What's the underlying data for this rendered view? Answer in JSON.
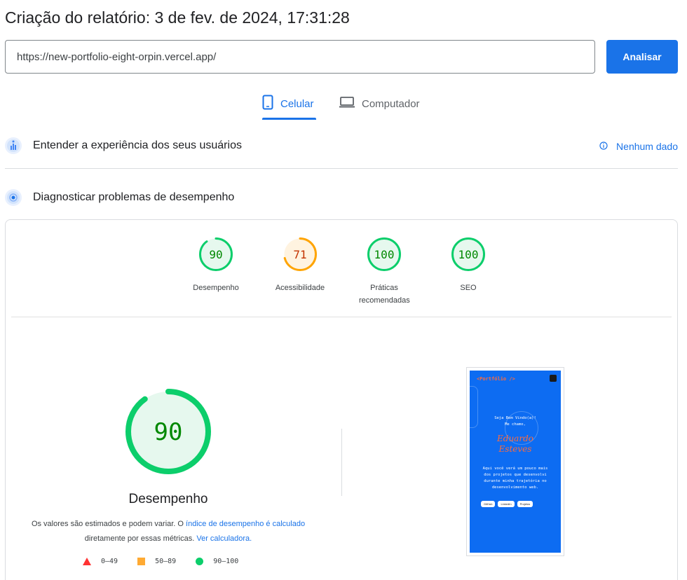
{
  "header": {
    "title": "Criação do relatório: 3 de fev. de 2024, 17:31:28"
  },
  "search": {
    "url": "https://new-portfolio-eight-orpin.vercel.app/",
    "button_label": "Analisar"
  },
  "tabs": [
    {
      "label": "Celular",
      "icon": "phone-icon",
      "active": true
    },
    {
      "label": "Computador",
      "icon": "laptop-icon",
      "active": false
    }
  ],
  "sections": {
    "experience": {
      "label": "Entender a experiência dos seus usuários",
      "status": "Nenhum dado"
    },
    "diagnostics": {
      "label": "Diagnosticar problemas de desempenho"
    }
  },
  "scores": [
    {
      "label": "Desempenho",
      "value": "90",
      "level": 0.9,
      "color": "#0cce6b",
      "fill": "#e6f8ee",
      "text_color": "#008800"
    },
    {
      "label": "Acessibilidade",
      "value": "71",
      "level": 0.71,
      "color": "#ffa400",
      "fill": "#fff3e0",
      "text_color": "#c33300"
    },
    {
      "label": "Práticas recomendadas",
      "value": "100",
      "level": 1.0,
      "color": "#0cce6b",
      "fill": "#e6f8ee",
      "text_color": "#008800"
    },
    {
      "label": "SEO",
      "value": "100",
      "level": 1.0,
      "color": "#0cce6b",
      "fill": "#e6f8ee",
      "text_color": "#008800"
    }
  ],
  "performance": {
    "value": "90",
    "level": 0.9,
    "label": "Desempenho",
    "note_prefix": "Os valores são estimados e podem variar. O ",
    "note_link1": "índice de desempenho é calculado",
    "note_mid": " diretamente por essas métricas. ",
    "note_link2": "Ver calculadora."
  },
  "legend": [
    {
      "shape": "triangle",
      "range": "0–49",
      "color": "#ff3333"
    },
    {
      "shape": "square",
      "range": "50–89",
      "color": "#ffaa33"
    },
    {
      "shape": "circle",
      "range": "90–100",
      "color": "#0cce6b"
    }
  ],
  "screenshot": {
    "brand": "<Portfólio />",
    "greeting": "Seja Bem Vindo(a)!",
    "intro": "Me chamo,",
    "name_line1": "Eduardo",
    "name_line2": "Esteves",
    "bio_lines": [
      "Aqui você verá um pouco mais",
      "dos projetos que desenvolvi",
      "durante minha trajetória no",
      "desenvolvimento web."
    ],
    "buttons": [
      "GitHub",
      "LinkedIn",
      "Projetos"
    ]
  }
}
